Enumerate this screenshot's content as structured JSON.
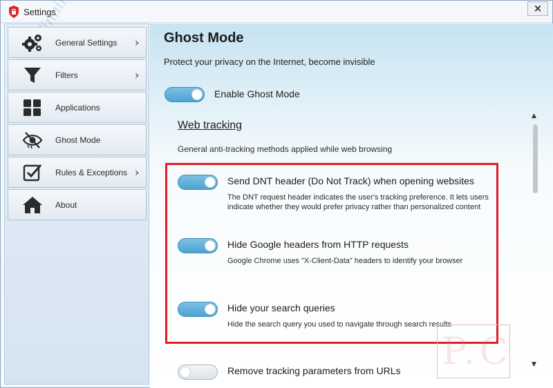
{
  "window": {
    "title": "Settings",
    "close_symbol": "×",
    "app_icon": "shield-lock-icon"
  },
  "sidebar": {
    "items": [
      {
        "label": "General Settings",
        "icon": "gears-icon",
        "has_submenu": true
      },
      {
        "label": "Filters",
        "icon": "funnel-icon",
        "has_submenu": true
      },
      {
        "label": "Applications",
        "icon": "grid-icon",
        "has_submenu": false
      },
      {
        "label": "Ghost Mode",
        "icon": "eye-hidden-icon",
        "has_submenu": false
      },
      {
        "label": "Rules & Exceptions",
        "icon": "checkbox-icon",
        "has_submenu": true
      },
      {
        "label": "About",
        "icon": "home-icon",
        "has_submenu": false
      }
    ],
    "chevron": "›",
    "watermark": "WinningPC"
  },
  "main": {
    "title": "Ghost Mode",
    "subtitle": "Protect your privacy on the Internet, become invisible",
    "enable_label": "Enable Ghost Mode",
    "enable_on": true,
    "section_heading": "Web tracking",
    "section_desc": "General anti-tracking methods applied while web browsing",
    "options": [
      {
        "title": "Send DNT header (Do Not Track) when opening websites",
        "desc": "The DNT request header indicates the user's tracking preference. It lets users indicate whether they would prefer privacy rather than personalized content",
        "on": true
      },
      {
        "title": "Hide Google headers from HTTP requests",
        "desc": "Google Chrome uses \"X-Client-Data\" headers to identify your browser",
        "on": true
      },
      {
        "title": "Hide your search queries",
        "desc": "Hide the search query you used to navigate through search results",
        "on": true
      },
      {
        "title": "Remove tracking parameters from URLs",
        "desc": "",
        "on": false
      }
    ],
    "scroll_up": "▲",
    "scroll_down": "▼",
    "logo_text": "P.C"
  },
  "colors": {
    "accent": "#4ea3d3",
    "highlight": "#e01b24"
  }
}
